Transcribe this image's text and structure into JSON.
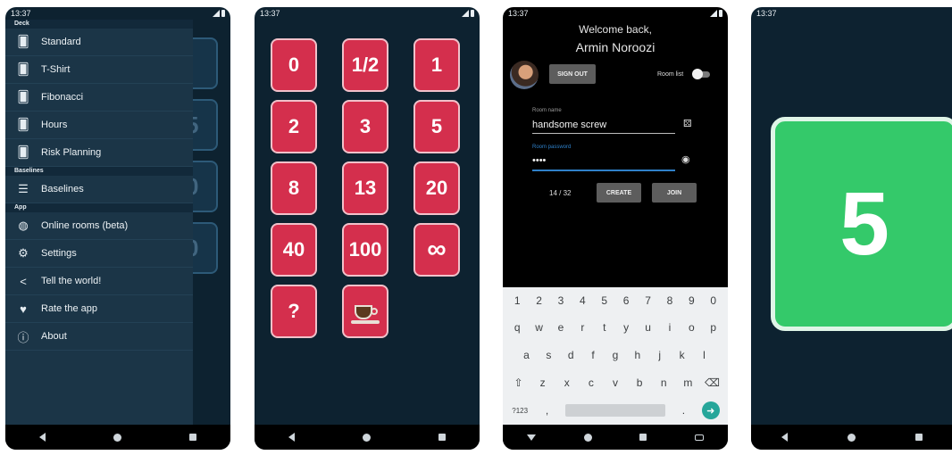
{
  "status_time": "13:37",
  "phone1": {
    "sections": {
      "deck": "Deck",
      "baselines": "Baselines",
      "app": "App"
    },
    "deck_items": [
      {
        "label": "Standard",
        "icon": "cards-icon"
      },
      {
        "label": "T-Shirt",
        "icon": "cards-icon"
      },
      {
        "label": "Fibonacci",
        "icon": "cards-icon"
      },
      {
        "label": "Hours",
        "icon": "cards-icon"
      },
      {
        "label": "Risk Planning",
        "icon": "cards-icon"
      }
    ],
    "baseline_items": [
      {
        "label": "Baselines",
        "icon": "list-icon"
      }
    ],
    "app_items": [
      {
        "label": "Online rooms (beta)",
        "icon": "globe-icon"
      },
      {
        "label": "Settings",
        "icon": "gear-icon"
      },
      {
        "label": "Tell the world!",
        "icon": "share-icon"
      },
      {
        "label": "Rate the app",
        "icon": "heart-icon"
      },
      {
        "label": "About",
        "icon": "info-icon"
      }
    ],
    "background_card_digits": [
      "",
      "5",
      "0",
      "0"
    ]
  },
  "phone2": {
    "cards": [
      "0",
      "1/2",
      "1",
      "2",
      "3",
      "5",
      "8",
      "13",
      "20",
      "40",
      "100",
      "∞",
      "?",
      ""
    ],
    "coffee_card_icon": "coffee-cup-icon"
  },
  "phone3": {
    "welcome": "Welcome back,",
    "username": "Armin Noroozi",
    "sign_out_label": "SIGN OUT",
    "room_list_label": "Room list",
    "room_name_label": "Room name",
    "room_name_value": "handsome screw",
    "room_password_label": "Room password",
    "room_password_value": "••••",
    "counter": "14 / 32",
    "create_label": "CREATE",
    "join_label": "JOIN",
    "keyboard": {
      "row_numbers": [
        "1",
        "2",
        "3",
        "4",
        "5",
        "6",
        "7",
        "8",
        "9",
        "0"
      ],
      "row1": [
        "q",
        "w",
        "e",
        "r",
        "t",
        "y",
        "u",
        "i",
        "o",
        "p"
      ],
      "row2": [
        "a",
        "s",
        "d",
        "f",
        "g",
        "h",
        "j",
        "k",
        "l"
      ],
      "row3": [
        "⇧",
        "z",
        "x",
        "c",
        "v",
        "b",
        "n",
        "m",
        "⌫"
      ],
      "symbols_key": "?123",
      "comma_key": ",",
      "period_key": "."
    },
    "accent_color": "#2f80c9"
  },
  "phone4": {
    "card_value": "5",
    "card_color": "#34c96a"
  },
  "colors": {
    "app_background": "#0d2230",
    "card_red": "#d42f4d"
  }
}
